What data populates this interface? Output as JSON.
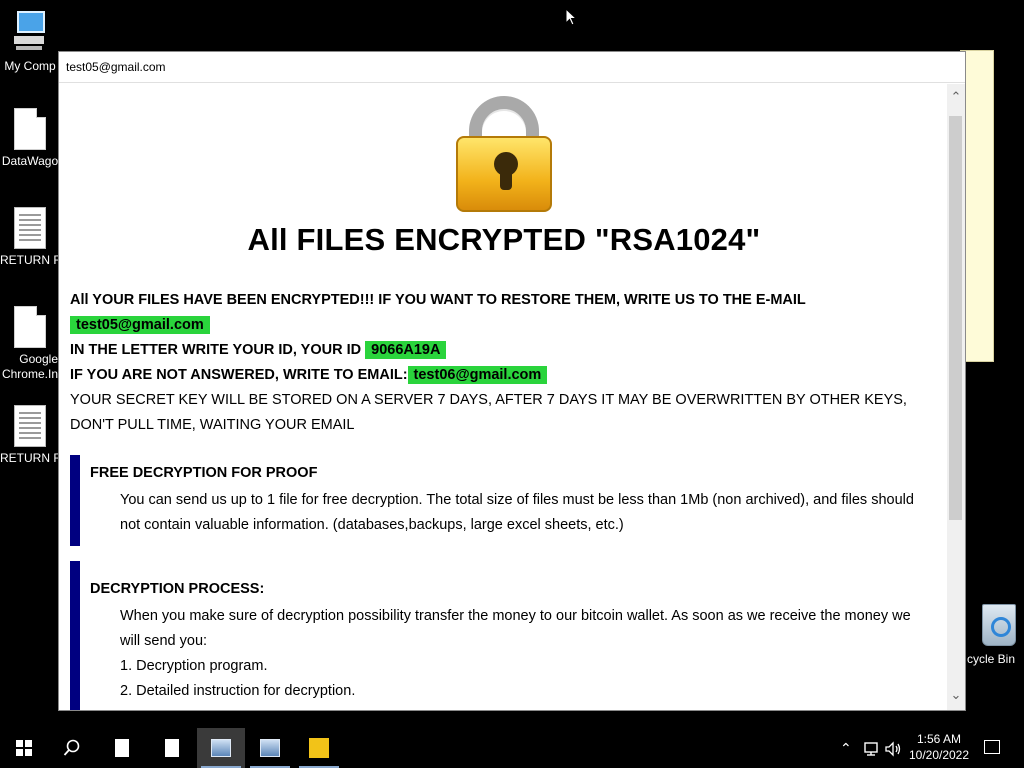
{
  "desktop": {
    "icons": [
      {
        "label": "My Comp",
        "icon": "computer-icon"
      },
      {
        "label": "DataWago",
        "icon": "file-icon"
      },
      {
        "label": "RETURN FI",
        "icon": "text-file-icon"
      },
      {
        "label": "Google Chrome.In",
        "icon": "file-icon"
      },
      {
        "label": "RETURN FI",
        "icon": "text-file-icon"
      }
    ],
    "recycle_bin_label": "cycle Bin"
  },
  "window": {
    "title": "test05@gmail.com",
    "headline": "All FILES ENCRYPTED \"RSA1024\"",
    "line1": "All YOUR FILES HAVE BEEN ENCRYPTED!!! IF YOU WANT TO RESTORE THEM, WRITE US TO THE E-MAIL",
    "email1": "test05@gmail.com",
    "line2": "IN THE LETTER WRITE YOUR ID, YOUR ID",
    "user_id": "9066A19A",
    "line3": "IF YOU ARE NOT ANSWERED, WRITE TO EMAIL:",
    "email2": "test06@gmail.com",
    "line4": "YOUR SECRET KEY WILL BE STORED ON A SERVER 7 DAYS, AFTER 7 DAYS IT MAY BE OVERWRITTEN BY OTHER KEYS, DON'T PULL TIME, WAITING YOUR EMAIL",
    "free_title": "FREE DECRYPTION FOR PROOF",
    "free_text": "You can send us up to 1 file for free decryption. The total size of files must be less than 1Mb (non archived), and files should not contain valuable information. (databases,backups, large excel sheets, etc.)",
    "process_title": "DECRYPTION PROCESS:",
    "process_text": "When you make sure of decryption possibility transfer the money to our bitcoin wallet. As soon as we receive the money we will send you:",
    "process_items": [
      "1. Decryption program.",
      "2. Detailed instruction for decryption."
    ],
    "accent_color": "#000080",
    "highlight_color": "#2ad43c"
  },
  "taskbar": {
    "time": "1:56 AM",
    "date": "10/20/2022",
    "tray_icons": [
      "chevron-up-icon",
      "network-icon",
      "volume-icon"
    ]
  }
}
